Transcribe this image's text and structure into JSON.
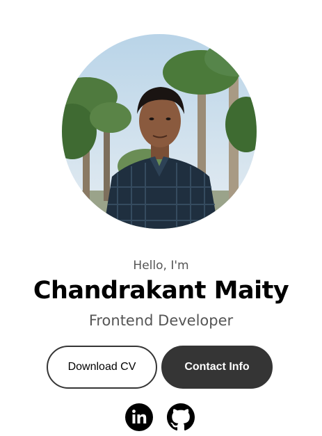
{
  "profile": {
    "greeting": "Hello, I'm",
    "name": "Chandrakant Maity",
    "role": "Frontend Developer"
  },
  "buttons": {
    "download_cv": "Download CV",
    "contact_info": "Contact Info"
  },
  "socials": [
    {
      "icon": "linkedin-icon"
    },
    {
      "icon": "github-icon"
    }
  ],
  "colors": {
    "dark": "#353535",
    "muted_text": "#555555",
    "background": "#ffffff"
  }
}
